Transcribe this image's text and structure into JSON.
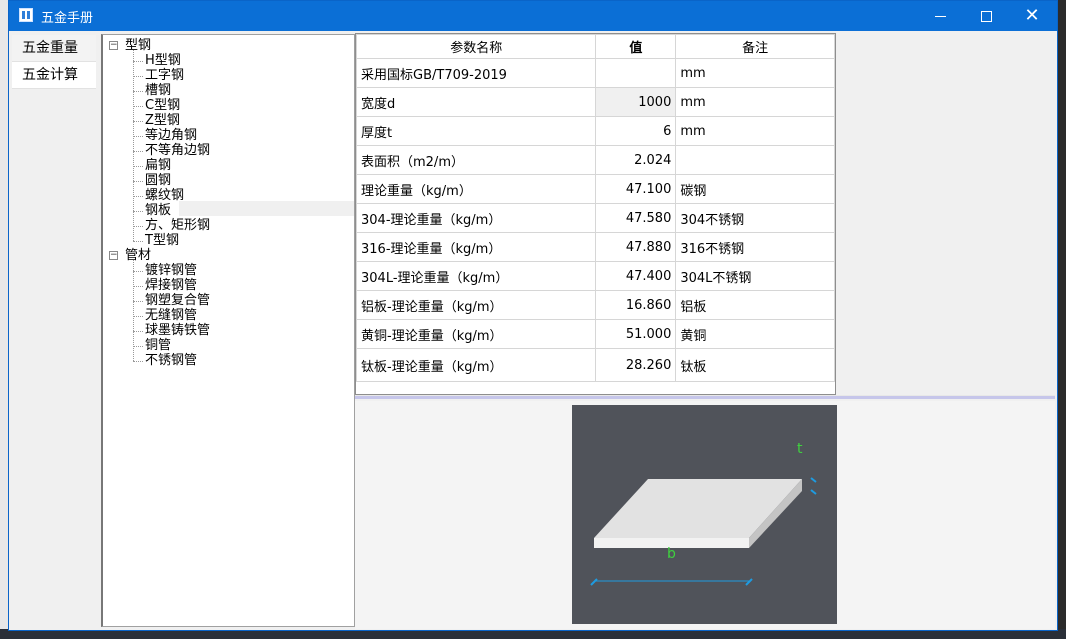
{
  "window": {
    "title": "五金手册"
  },
  "sidebar": {
    "items": [
      {
        "label": "五金重量",
        "active": false
      },
      {
        "label": "五金计算",
        "active": true
      }
    ]
  },
  "tree": {
    "groups": [
      {
        "label": "型钢",
        "expanded": true,
        "children": [
          "H型钢",
          "工字钢",
          "槽钢",
          "C型钢",
          "Z型钢",
          "等边角钢",
          "不等角边钢",
          "扁钢",
          "圆钢",
          "螺纹钢",
          "钢板",
          "方、矩形钢",
          "T型钢"
        ]
      },
      {
        "label": "管材",
        "expanded": true,
        "children": [
          "镀锌钢管",
          "焊接钢管",
          "钢塑复合管",
          "无缝钢管",
          "球墨铸铁管",
          "铜管",
          "不锈钢管"
        ]
      }
    ],
    "selected": "钢板"
  },
  "params": {
    "headers": {
      "name": "参数名称",
      "value": "值",
      "note": "备注"
    },
    "rows": [
      {
        "name": "采用国标GB/T709-2019",
        "value": "",
        "note": "mm",
        "editable": false
      },
      {
        "name": "宽度d",
        "value": "1000",
        "note": "mm",
        "editable": true
      },
      {
        "name": "厚度t",
        "value": "6",
        "note": "mm",
        "editable": false
      },
      {
        "name": "表面积（m2/m）",
        "value": "2.024",
        "note": "",
        "editable": false
      },
      {
        "name": "理论重量（kg/m）",
        "value": "47.100",
        "note": "碳钢",
        "editable": false
      },
      {
        "name": "304-理论重量（kg/m）",
        "value": "47.580",
        "note": "304不锈钢",
        "editable": false
      },
      {
        "name": "316-理论重量（kg/m）",
        "value": "47.880",
        "note": "316不锈钢",
        "editable": false
      },
      {
        "name": "304L-理论重量（kg/m）",
        "value": "47.400",
        "note": "304L不锈钢",
        "editable": false
      },
      {
        "name": "铝板-理论重量（kg/m）",
        "value": "16.860",
        "note": "铝板",
        "editable": false
      },
      {
        "name": "黄铜-理论重量（kg/m）",
        "value": "51.000",
        "note": "黄铜",
        "editable": false
      },
      {
        "name": "钛板-理论重量（kg/m）",
        "value": "28.260",
        "note": "钛板",
        "editable": false
      }
    ]
  },
  "diagram": {
    "label_thickness": "t",
    "label_width": "b",
    "colors": {
      "background": "#50535a",
      "plate_top": "#e2e2e2",
      "plate_front": "#f2f2f2",
      "plate_side": "#c4c4c4",
      "label": "#3fd13f",
      "dimension": "#1e9be0"
    }
  }
}
